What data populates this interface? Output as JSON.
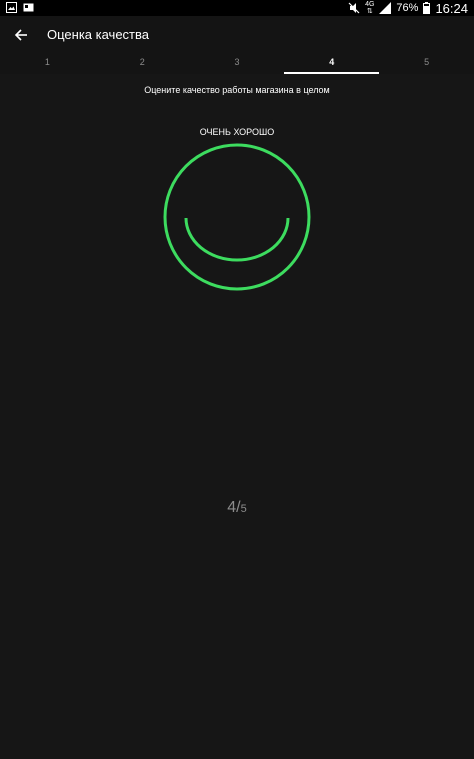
{
  "status_bar": {
    "net_type": "4G",
    "battery": "76%",
    "time": "16:24"
  },
  "toolbar": {
    "title": "Оценка качества"
  },
  "tabs": [
    {
      "label": "1"
    },
    {
      "label": "2"
    },
    {
      "label": "3"
    },
    {
      "label": "4",
      "active": true
    },
    {
      "label": "5"
    }
  ],
  "rating": {
    "prompt": "Оцените качество работы магазина в целом",
    "label": "ОЧЕНЬ ХОРОШО",
    "value": "4",
    "max": "5",
    "accent_color": "#3ddc5f"
  }
}
